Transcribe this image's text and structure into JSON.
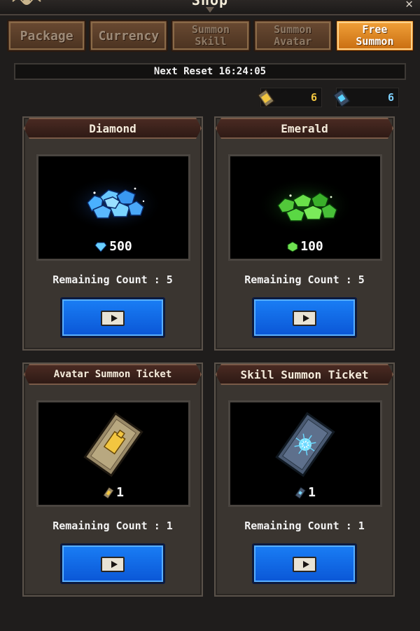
{
  "header": {
    "title": "Shop",
    "close_label": "✕"
  },
  "tabs": [
    {
      "label": "Package",
      "active": false
    },
    {
      "label": "Currency",
      "active": false
    },
    {
      "label": "Summon\nSkill",
      "active": false
    },
    {
      "label": "Summon\nAvatar",
      "active": false
    },
    {
      "label": "Free\nSummon",
      "active": true
    }
  ],
  "reset": {
    "label": "Next Reset 16:24:05"
  },
  "counters": {
    "avatar_ticket": "6",
    "skill_ticket": "6"
  },
  "cards": {
    "diamond": {
      "title": "Diamond",
      "amount": "500",
      "remaining": "Remaining Count : 5"
    },
    "emerald": {
      "title": "Emerald",
      "amount": "100",
      "remaining": "Remaining Count : 5"
    },
    "avatar": {
      "title": "Avatar Summon Ticket",
      "amount": "1",
      "remaining": "Remaining Count : 1"
    },
    "skill": {
      "title": "Skill Summon Ticket",
      "amount": "1",
      "remaining": "Remaining Count : 1"
    }
  },
  "icons": {
    "diamond": "diamond-icon",
    "emerald": "emerald-icon",
    "avatar_ticket": "avatar-ticket-icon",
    "skill_ticket": "skill-ticket-icon",
    "play": "play-icon"
  },
  "colors": {
    "active_tab": "#e88a22",
    "button": "#1268e8",
    "gold": "#f2c640",
    "blue": "#7fd2ff"
  }
}
